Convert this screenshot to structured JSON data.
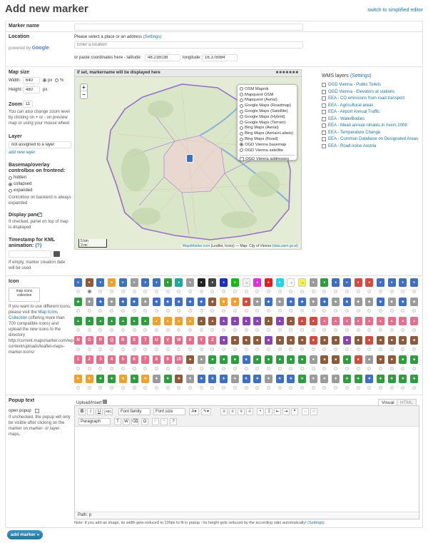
{
  "header": {
    "title": "Add new marker",
    "switch_link": "switch to simplified editor"
  },
  "marker_name": {
    "label": "Marker name",
    "value": ""
  },
  "location": {
    "label": "Location",
    "powered_by": "powered by",
    "google": "Google",
    "hint": "Please select a place or an address",
    "settings": "(Settings)",
    "placeholder": "Enter a location",
    "coords_hint": "or paste coordinates here - latitude:",
    "latitude": "48.216038",
    "longitude_label": "longitude:",
    "longitude": "16.378984"
  },
  "map_size": {
    "label": "Map size",
    "width_label": "Width:",
    "width": "640",
    "px": "px",
    "pct": "%",
    "height_label": "Height:",
    "height": "480",
    "px2": "px"
  },
  "zoom": {
    "label": "Zoom",
    "value": "11",
    "help": "You can also change zoom level by clicking on + or - on preview map or using your mouse wheel"
  },
  "layer": {
    "label": "Layer",
    "value": "not assigned to a layer",
    "add_new": "add new layer"
  },
  "basemap": {
    "label": "Basemap/overlay controlbox on frontend:",
    "options": [
      "hidden",
      "collapsed",
      "expanded"
    ],
    "selected": "collapsed",
    "help": "Controlbox on backend is always expanded"
  },
  "display_panel": {
    "label": "Display panel",
    "help": "If checked, panel on top of map is displayed"
  },
  "timestamp": {
    "label": "Timestamp for KML animation:",
    "help_link": "(?)",
    "help": "If empty, marker creation date will be used"
  },
  "map": {
    "bar_text": "if set, markername will be displayed here",
    "zoom_in": "+",
    "zoom_out": "−",
    "layers": [
      "OSM Mapnik",
      "Mapquest OSM",
      "Mapquest (Aerial)",
      "Google Maps (Roadmap)",
      "Google Maps (Satellite)",
      "Google Maps (Hybrid)",
      "Google Maps (Terrain)",
      "Bing Maps (Aerial)",
      "Bing Maps (Aerial+Labels)",
      "Bing Maps (Road)",
      "OGD Vienna basemap",
      "OGD Vienna satellite"
    ],
    "selected_layer": "OGD Vienna basemap",
    "overlay": "OGD Vienna addresses",
    "scale_km": "5 km",
    "scale_mi": "3 mi",
    "attribution_link": "MapsMarker.com",
    "attribution_paren": "(Leaflet, Icons)",
    "attribution_rest": "— Map: City of Vienna",
    "attribution_data": "(data.wien.gv.at)"
  },
  "wms": {
    "label": "WMS layers",
    "settings": "(Settings)",
    "items": [
      "OGD Vienna - Public Toilets",
      "OGD Vienna - Elevators at stations",
      "EEA - CO emissions from road transport",
      "EEA - Agricultural areas",
      "EEA - Airport Annual Traffic",
      "EEA - WaterBodies",
      "EEA - Mean annual nitrates in rivers 2008",
      "EEA - Temperature Change",
      "EEA - Common Database on Designated Areas",
      "EEA - Road noise Austria"
    ]
  },
  "icon": {
    "label": "Icon",
    "logo_text": "map icons collection",
    "help_pre": "If you want to use different icons, please visit the",
    "help_link": "Map Icons Collection",
    "help_post": "(offering more than 700 compatible icons) and upload the new icons to the directory http://current.mapsmarker.com/wp-content/uploads/leaflet-maps-marker-icons/",
    "letters": [
      "A",
      "B",
      "C",
      "D",
      "E",
      "F",
      "G",
      "H",
      "I",
      "J",
      "K",
      "L",
      "M",
      "N",
      "O",
      "P",
      "Q",
      "R",
      "S",
      "T",
      "U",
      "V",
      "W",
      "X",
      "Y",
      "Z",
      "1",
      "2",
      "3",
      "4",
      "5",
      "6",
      "7",
      "8",
      "9",
      "10"
    ],
    "colors": {
      "blue": "#3d6fc4",
      "green": "#2e9c3f",
      "orange": "#f0a12c",
      "red": "#d24b3d",
      "purple": "#8a44b4",
      "brown": "#8e5a3c",
      "gray": "#9b9b9b",
      "pink": "#e86d8b",
      "teal": "#1aa9a0"
    }
  },
  "popup": {
    "label": "Popup text",
    "open_label": "open popup",
    "open_help": "If unchecked, the popup will only be visible after clicking on the marker on marker- or layer-maps.",
    "upload": "Upload/Insert",
    "tab_visual": "Visual",
    "tab_html": "HTML",
    "font_family": "Font family",
    "font_size": "Font size",
    "paragraph": "Paragraph",
    "path": "Path: p",
    "note": "Note: if you add an image, its width gets reduced to 230px to fit in popup - its height gets reduced by the according ratio automatically!",
    "note_link": "(Settings)"
  },
  "submit": {
    "label": "add marker »"
  }
}
